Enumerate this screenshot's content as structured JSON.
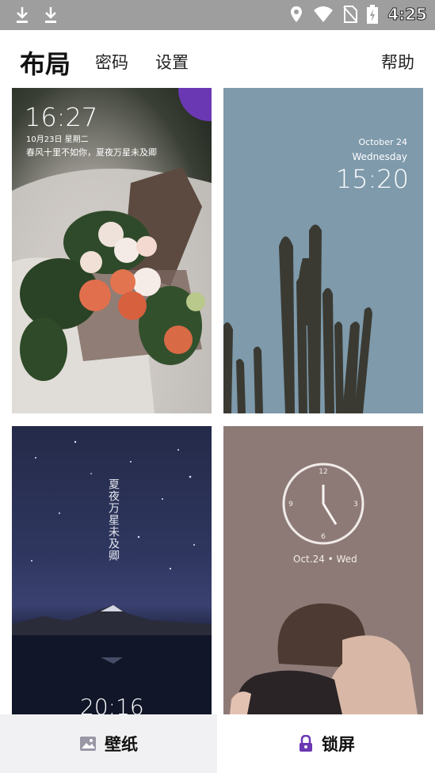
{
  "status_bar": {
    "time": "4:25"
  },
  "header": {
    "title": "布局",
    "tabs": [
      {
        "label": "密码"
      },
      {
        "label": "设置"
      }
    ],
    "help": "帮助"
  },
  "cards": [
    {
      "time": "16:27",
      "date": "10月23日 星期二",
      "quote": "春风十里不如你，夏夜万星未及卿",
      "selected": true
    },
    {
      "date": "October 24",
      "weekday": "Wednesday",
      "time": "15:20"
    },
    {
      "vertical_text": "夏夜万星未及卿",
      "time": "20:16"
    },
    {
      "date": "Oct.24 • Wed",
      "clock_numbers": [
        "12",
        "3",
        "6",
        "9"
      ]
    }
  ],
  "bottom_nav": [
    {
      "label": "壁纸",
      "icon": "image-icon"
    },
    {
      "label": "锁屏",
      "icon": "lock-icon"
    }
  ],
  "colors": {
    "accent": "#6b38b4"
  }
}
